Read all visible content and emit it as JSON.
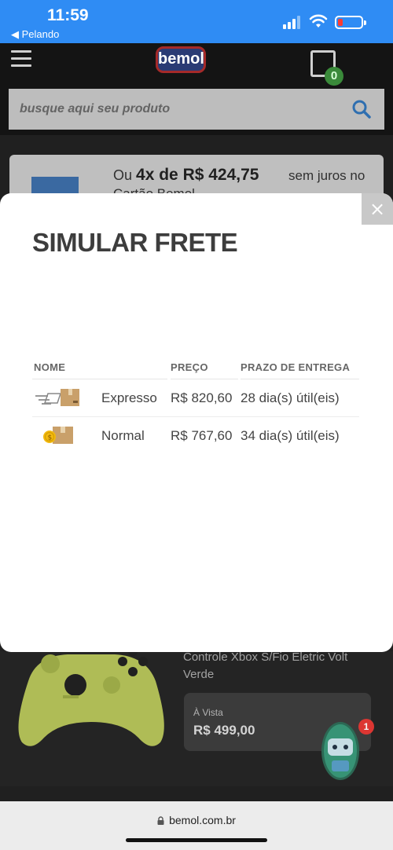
{
  "status_bar": {
    "time": "11:59",
    "back_label": "◀ Pelando",
    "colors": {
      "background": "#2f8cf4",
      "battery_low": "#ff3b30"
    }
  },
  "header": {
    "logo_text": "bemol",
    "cart_count": "0",
    "search_placeholder": "busque aqui seu produto",
    "icons": [
      "hamburger-menu-icon",
      "shopping-bag-icon",
      "search-icon"
    ]
  },
  "promo": {
    "prefix": "Ou",
    "highlight": "4x de R$ 424,75",
    "suffix": "sem juros no",
    "subline": "Cartão Bemol"
  },
  "modal": {
    "title": "SIMULAR FRETE",
    "close_label": "×",
    "columns": [
      "NOME",
      "PREÇO",
      "PRAZO DE ENTREGA"
    ],
    "rows": [
      {
        "icon": "express-delivery-box-icon",
        "name": "Expresso",
        "price": "R$ 820,60",
        "deadline": "28 dia(s) útil(eis)"
      },
      {
        "icon": "coin-delivery-box-icon",
        "name": "Normal",
        "price": "R$ 767,60",
        "deadline": "34 dia(s) útil(eis)"
      }
    ]
  },
  "product": {
    "name": "Controle Xbox S/Fio Eletric Volt Verde",
    "price_label": "À Vista",
    "price": "R$ 499,00",
    "chat_badge": "1"
  },
  "browser": {
    "url": "bemol.com.br"
  }
}
